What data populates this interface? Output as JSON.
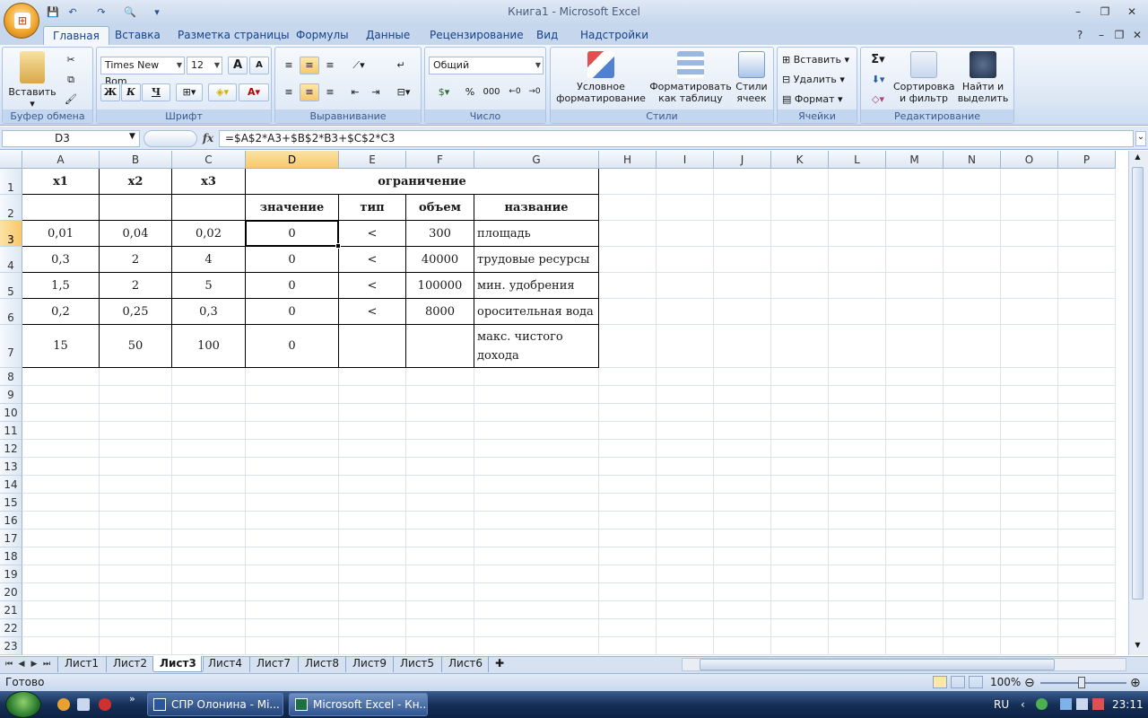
{
  "window": {
    "title": "Книга1 - Microsoft Excel"
  },
  "qat": {
    "save": "💾",
    "undo": "↶",
    "redo": "↷",
    "preview": "🔍",
    "custom": "▾"
  },
  "tabs": [
    "Главная",
    "Вставка",
    "Разметка страницы",
    "Формулы",
    "Данные",
    "Рецензирование",
    "Вид",
    "Надстройки"
  ],
  "ribbon": {
    "clipboard": {
      "label": "Буфер обмена",
      "paste": "Вставить"
    },
    "font": {
      "label": "Шрифт",
      "name": "Times New Rom",
      "size": "12",
      "bold": "Ж",
      "italic": "К",
      "underline": "Ч",
      "grow": "A",
      "shrink": "A"
    },
    "alignment": {
      "label": "Выравнивание"
    },
    "number": {
      "label": "Число",
      "format": "Общий",
      "percent": "%",
      "thousands": "000"
    },
    "styles": {
      "label": "Стили",
      "conditional": "Условное форматирование",
      "as_table": "Форматировать как таблицу",
      "cell_styles": "Стили ячеек"
    },
    "cells": {
      "label": "Ячейки",
      "insert": "Вставить",
      "delete": "Удалить",
      "format": "Формат"
    },
    "editing": {
      "label": "Редактирование",
      "sum": "Σ",
      "sort": "Сортировка и фильтр",
      "find": "Найти и выделить"
    }
  },
  "formula_bar": {
    "name_box": "D3",
    "formula": "=$A$2*A3+$B$2*B3+$C$2*C3",
    "fx": "fx"
  },
  "columns": [
    "A",
    "B",
    "C",
    "D",
    "E",
    "F",
    "G",
    "H",
    "I",
    "J",
    "K",
    "L",
    "M",
    "N",
    "O",
    "P"
  ],
  "rows": [
    "1",
    "2",
    "3",
    "4",
    "5",
    "6",
    "7",
    "8",
    "9",
    "10",
    "11",
    "12",
    "13",
    "14",
    "15",
    "16",
    "17",
    "18",
    "19",
    "20",
    "21",
    "22",
    "23"
  ],
  "cells": {
    "r1": {
      "A": "x1",
      "B": "x2",
      "C": "x3",
      "DG": "ограничение"
    },
    "r2": {
      "D": "значение",
      "E": "тип",
      "F": "объем",
      "G": "название"
    },
    "r3": {
      "A": "0,01",
      "B": "0,04",
      "C": "0,02",
      "D": "0",
      "E": "<",
      "F": "300",
      "G": "площадь"
    },
    "r4": {
      "A": "0,3",
      "B": "2",
      "C": "4",
      "D": "0",
      "E": "<",
      "F": "40000",
      "G": "трудовые ресурсы"
    },
    "r5": {
      "A": "1,5",
      "B": "2",
      "C": "5",
      "D": "0",
      "E": "<",
      "F": "100000",
      "G": "мин. удобрения"
    },
    "r6": {
      "A": "0,2",
      "B": "0,25",
      "C": "0,3",
      "D": "0",
      "E": "<",
      "F": "8000",
      "G": "оросительная вода"
    },
    "r7": {
      "A": "15",
      "B": "50",
      "C": "100",
      "D": "0",
      "G": "макс. чистого дохода"
    }
  },
  "sheets": [
    "Лист1",
    "Лист2",
    "Лист3",
    "Лист4",
    "Лист7",
    "Лист8",
    "Лист9",
    "Лист5",
    "Лист6"
  ],
  "active_sheet": "Лист3",
  "status": {
    "text": "Готово",
    "zoom": "100%"
  },
  "taskbar": {
    "items": [
      "СПР Олонина - Mi...",
      "Microsoft Excel - Кн..."
    ],
    "lang": "RU",
    "time": "23:11"
  }
}
